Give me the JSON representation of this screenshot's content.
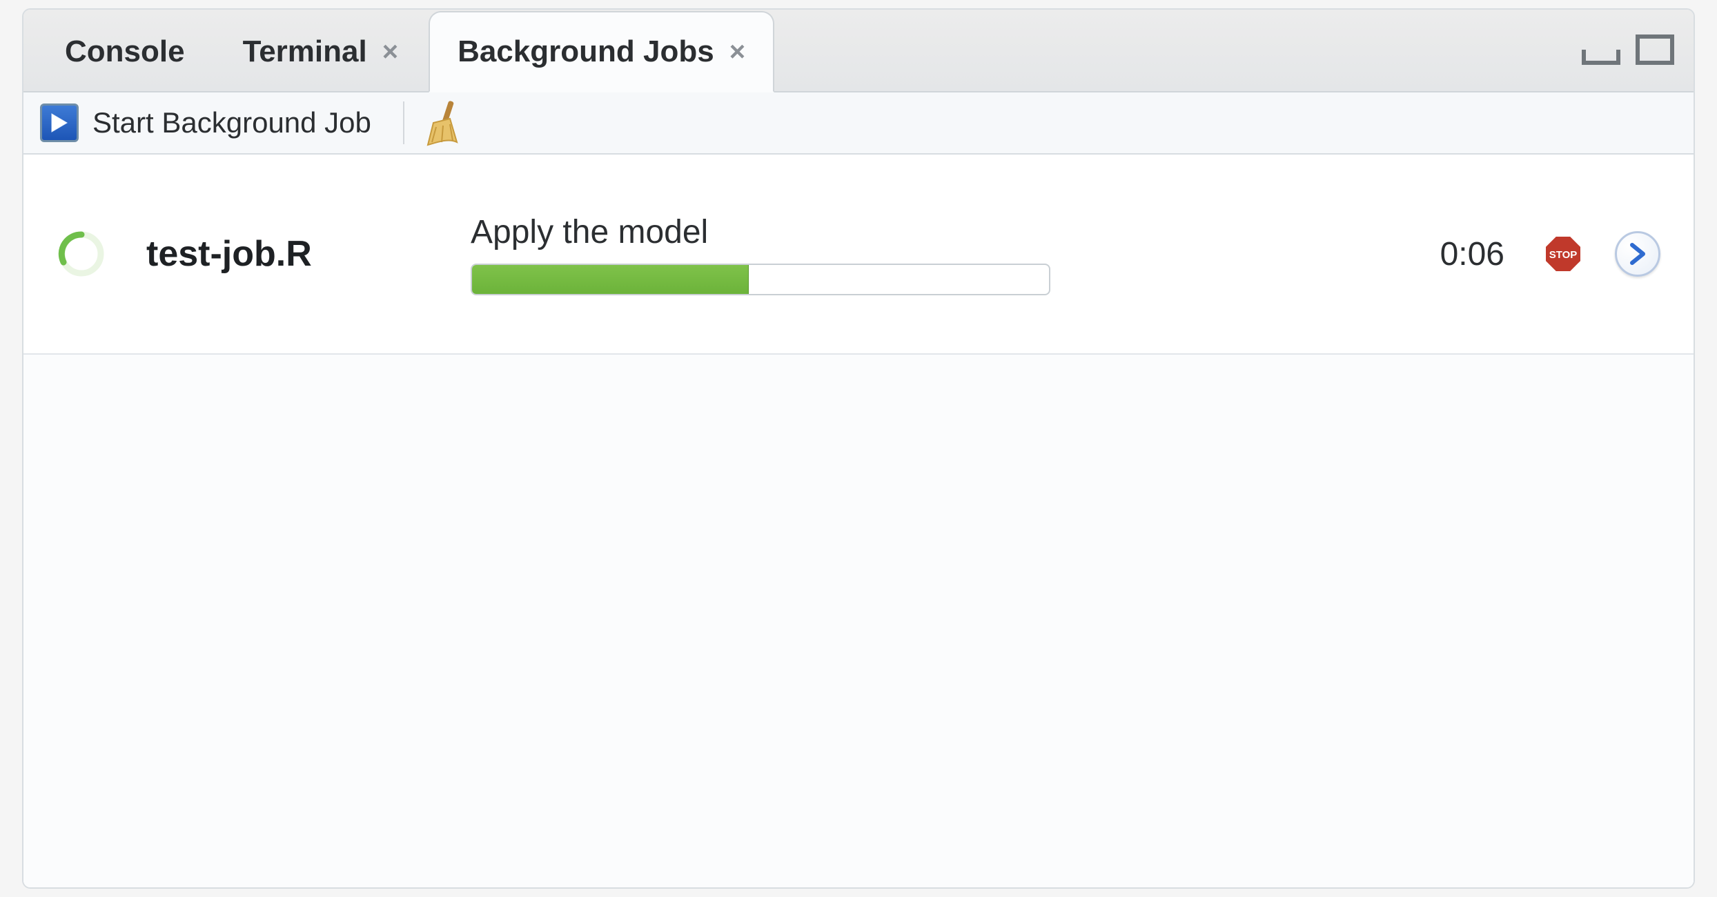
{
  "tabs": [
    {
      "label": "Console",
      "closeable": false,
      "active": false
    },
    {
      "label": "Terminal",
      "closeable": true,
      "active": false
    },
    {
      "label": "Background Jobs",
      "closeable": true,
      "active": true
    }
  ],
  "toolbar": {
    "start_label": "Start Background Job"
  },
  "jobs": [
    {
      "name": "test-job.R",
      "status_label": "Apply the model",
      "progress_percent": 48,
      "elapsed": "0:06"
    }
  ],
  "icons": {
    "stop_text": "STOP"
  }
}
